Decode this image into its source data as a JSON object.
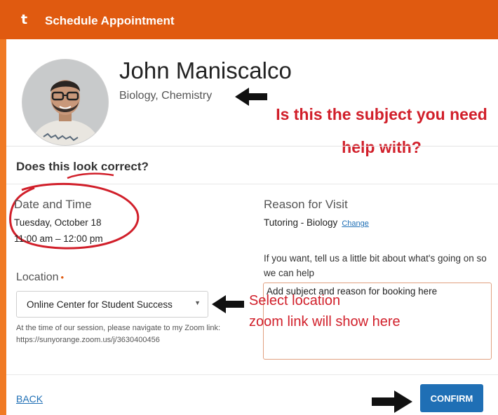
{
  "header": {
    "logo_glyph": "t",
    "title": "Schedule Appointment"
  },
  "profile": {
    "name": "John Maniscalco",
    "subjects": "Biology, Chemistry"
  },
  "annotations": {
    "subject_question": "Is this the subject you need help with?",
    "location_line1": "Select location",
    "location_line2": "zoom link will show here"
  },
  "confirm_section": {
    "question": "Does this look correct?"
  },
  "date_time": {
    "label": "Date and Time",
    "date": "Tuesday, October 18",
    "time": "11:00 am – 12:00 pm"
  },
  "reason": {
    "label": "Reason for Visit",
    "value": "Tutoring - Biology",
    "change_label": "Change",
    "prompt": "If you want, tell us a little bit about what's going on so we can help",
    "text": "Add subject and reason for booking here"
  },
  "location": {
    "label": "Location",
    "required_mark": "•",
    "selected": "Online Center for Student Success",
    "help_text": "At the time of our session, please navigate to my Zoom link: https://sunyorange.zoom.us/j/3630400456"
  },
  "footer": {
    "back_label": "BACK",
    "confirm_label": "CONFIRM"
  },
  "colors": {
    "frame": "#f07a24",
    "header": "#e05a10",
    "annotation": "#d11f2a",
    "primary": "#1f6fb5"
  },
  "icons": [
    "arrow-left-icon",
    "arrow-right-icon",
    "caret-down-icon"
  ]
}
